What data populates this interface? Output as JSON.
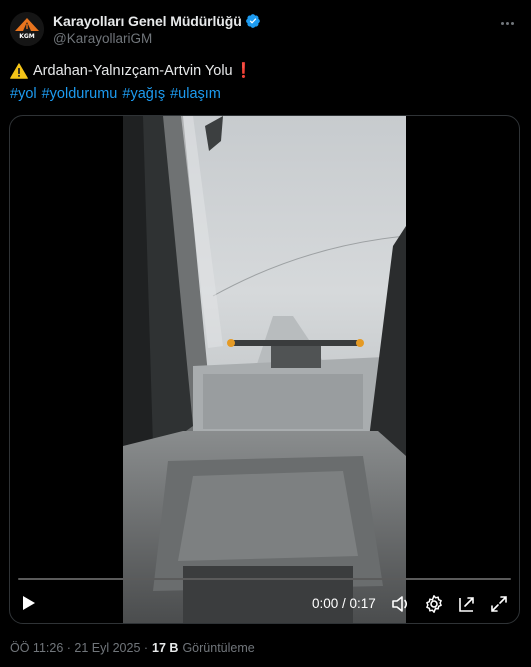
{
  "author": {
    "name": "Karayolları Genel Müdürlüğü",
    "handle": "@KarayollariGM",
    "avatar_text": "KGM",
    "verified_icon": "verified-badge-icon"
  },
  "tweet": {
    "title_emoji": "warning-icon",
    "title": "Ardahan-Yalnızçam-Artvin Yolu",
    "title_suffix": "❗",
    "hashtags": [
      "#yol",
      "#yoldurumu",
      "#yağış",
      "#ulaşım"
    ]
  },
  "video": {
    "time_display": "0:00 / 0:17",
    "progress": 0,
    "controls": [
      "play-icon",
      "volume-icon",
      "settings-icon",
      "picture-in-picture-icon",
      "fullscreen-icon"
    ]
  },
  "meta": {
    "timestamp": "ÖÖ 11:26 · 21 Eyl 2025 · ",
    "views": "17 B",
    "views_label": "Görüntüleme"
  },
  "colors": {
    "accent": "#1d9bf0",
    "secondary_text": "#71767b",
    "primary_text": "#e7e9ea"
  }
}
